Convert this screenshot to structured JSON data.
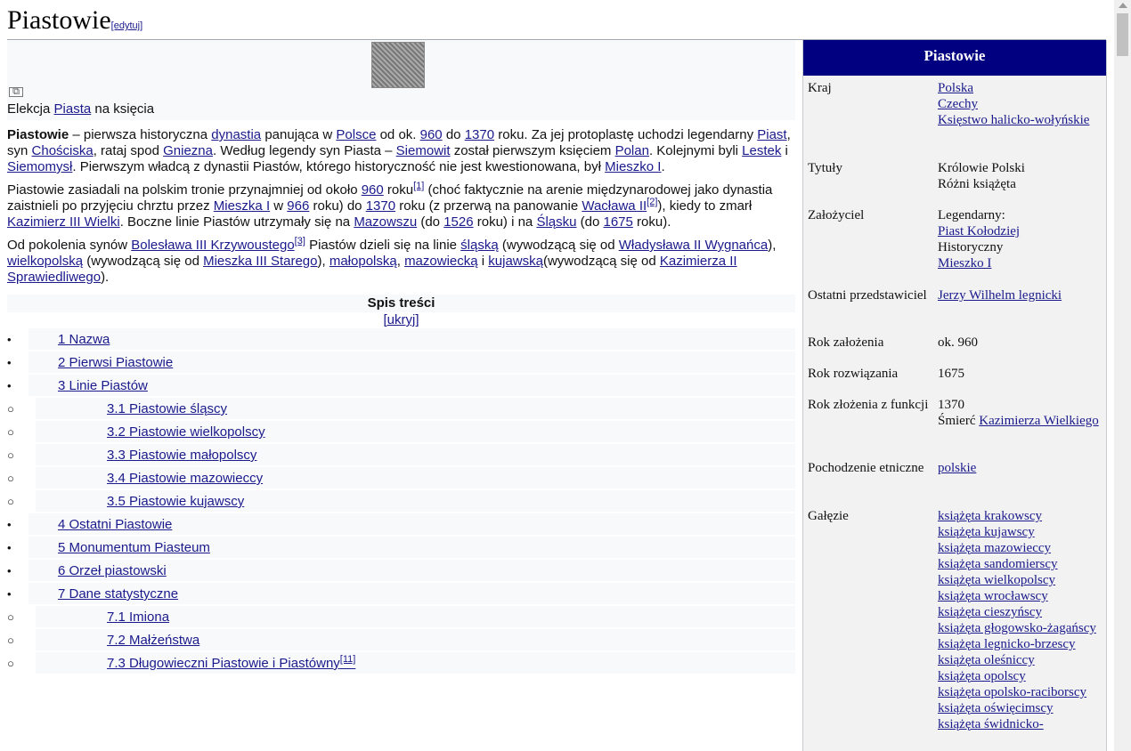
{
  "header": {
    "title": "Piastowie",
    "edit": "[edytuj]"
  },
  "figure": {
    "caption_pre": "Elekcja ",
    "caption_link": "Piasta",
    "caption_post": " na księcia"
  },
  "paragraphs": [
    [
      {
        "t": "b",
        "v": "Piastowie"
      },
      {
        "t": "s",
        "v": " – pierwsza historyczna "
      },
      {
        "t": "a",
        "v": "dynastia"
      },
      {
        "t": "s",
        "v": " panująca w "
      },
      {
        "t": "a",
        "v": "Polsce"
      },
      {
        "t": "s",
        "v": " od ok. "
      },
      {
        "t": "a",
        "v": "960"
      },
      {
        "t": "s",
        "v": " do "
      },
      {
        "t": "a",
        "v": "1370"
      },
      {
        "t": "s",
        "v": " roku. Za jej protoplastę uchodzi legendarny "
      },
      {
        "t": "a",
        "v": "Piast"
      },
      {
        "t": "s",
        "v": ", syn "
      },
      {
        "t": "a",
        "v": "Chościska"
      },
      {
        "t": "s",
        "v": ", rataj spod "
      },
      {
        "t": "a",
        "v": "Gniezna"
      },
      {
        "t": "s",
        "v": ". Według legendy syn Piasta – "
      },
      {
        "t": "a",
        "v": "Siemowit"
      },
      {
        "t": "s",
        "v": " został pierwszym księciem "
      },
      {
        "t": "a",
        "v": "Polan"
      },
      {
        "t": "s",
        "v": ". Kolejnymi byli "
      },
      {
        "t": "a",
        "v": "Lestek"
      },
      {
        "t": "s",
        "v": " i "
      },
      {
        "t": "a",
        "v": "Siemomysł"
      },
      {
        "t": "s",
        "v": ". Pierwszym władcą z dynastii Piastów, którego historyczność nie jest kwestionowana, był "
      },
      {
        "t": "a",
        "v": "Mieszko I"
      },
      {
        "t": "s",
        "v": "."
      }
    ],
    [
      {
        "t": "s",
        "v": "Piastowie zasiadali na polskim tronie przynajmniej od około "
      },
      {
        "t": "a",
        "v": "960"
      },
      {
        "t": "s",
        "v": " roku"
      },
      {
        "t": "sup",
        "v": "[1]"
      },
      {
        "t": "s",
        "v": " (choć faktycznie na arenie międzynarodowej jako dynastia zaistnieli po przyjęciu chrztu przez "
      },
      {
        "t": "a",
        "v": "Mieszka I"
      },
      {
        "t": "s",
        "v": " w "
      },
      {
        "t": "a",
        "v": "966"
      },
      {
        "t": "s",
        "v": " roku) do "
      },
      {
        "t": "a",
        "v": "1370"
      },
      {
        "t": "s",
        "v": " roku (z przerwą na panowanie "
      },
      {
        "t": "a",
        "v": "Wacława II"
      },
      {
        "t": "sup",
        "v": "[2]"
      },
      {
        "t": "s",
        "v": "), kiedy to zmarł "
      },
      {
        "t": "a",
        "v": "Kazimierz III Wielki"
      },
      {
        "t": "s",
        "v": ". Boczne linie Piastów utrzymały się na "
      },
      {
        "t": "a",
        "v": "Mazowszu"
      },
      {
        "t": "s",
        "v": " (do "
      },
      {
        "t": "a",
        "v": "1526"
      },
      {
        "t": "s",
        "v": " roku) i na "
      },
      {
        "t": "a",
        "v": "Śląsku"
      },
      {
        "t": "s",
        "v": " (do "
      },
      {
        "t": "a",
        "v": "1675"
      },
      {
        "t": "s",
        "v": " roku)."
      }
    ],
    [
      {
        "t": "s",
        "v": "Od pokolenia synów "
      },
      {
        "t": "a",
        "v": "Bolesława III Krzywoustego"
      },
      {
        "t": "sup",
        "v": "[3]"
      },
      {
        "t": "s",
        "v": " Piastów dzieli się na linie "
      },
      {
        "t": "a",
        "v": "śląską"
      },
      {
        "t": "s",
        "v": " (wywodzącą się od "
      },
      {
        "t": "a",
        "v": "Władysława II Wygnańca"
      },
      {
        "t": "s",
        "v": "), "
      },
      {
        "t": "a",
        "v": "wielkopolską"
      },
      {
        "t": "s",
        "v": " (wywodzącą się od "
      },
      {
        "t": "a",
        "v": "Mieszka III Starego"
      },
      {
        "t": "s",
        "v": "), "
      },
      {
        "t": "a",
        "v": "małopolską"
      },
      {
        "t": "s",
        "v": ", "
      },
      {
        "t": "a",
        "v": "mazowiecką"
      },
      {
        "t": "s",
        "v": " i "
      },
      {
        "t": "a",
        "v": "kujawską"
      },
      {
        "t": "s",
        "v": "(wywodzącą się od "
      },
      {
        "t": "a",
        "v": "Kazimierza II Sprawiedliwego"
      },
      {
        "t": "s",
        "v": ")."
      }
    ]
  ],
  "toc": {
    "title": "Spis treści",
    "hide": "[ukryj]",
    "items": [
      {
        "level": 1,
        "label": "1 Nazwa"
      },
      {
        "level": 1,
        "label": "2 Pierwsi Piastowie"
      },
      {
        "level": 1,
        "label": "3 Linie Piastów"
      },
      {
        "level": 2,
        "label": "3.1 Piastowie śląscy"
      },
      {
        "level": 2,
        "label": "3.2 Piastowie wielkopolscy"
      },
      {
        "level": 2,
        "label": "3.3 Piastowie małopolscy"
      },
      {
        "level": 2,
        "label": "3.4 Piastowie mazowieccy"
      },
      {
        "level": 2,
        "label": "3.5 Piastowie kujawscy"
      },
      {
        "level": 1,
        "label": "4 Ostatni Piastowie"
      },
      {
        "level": 1,
        "label": "5 Monumentum Piasteum"
      },
      {
        "level": 1,
        "label": "6 Orzeł piastowski"
      },
      {
        "level": 1,
        "label": "7 Dane statystyczne"
      },
      {
        "level": 2,
        "label": "7.1 Imiona"
      },
      {
        "level": 2,
        "label": "7.2 Małżeństwa"
      },
      {
        "level": 2,
        "label": "7.3 Długowieczni Piastowie i Piastówny",
        "sup": "[11]"
      }
    ]
  },
  "infobox": {
    "title": "Piastowie",
    "rows": [
      {
        "label": "Kraj",
        "value": [
          {
            "t": "a",
            "v": "Polska"
          },
          {
            "t": "br"
          },
          {
            "t": "a",
            "v": "Czechy"
          },
          {
            "t": "br"
          },
          {
            "t": "a",
            "v": "Księstwo halicko-wołyńskie"
          }
        ]
      },
      {
        "label": "Tytuły",
        "value": [
          {
            "t": "s",
            "v": "Królowie Polski"
          },
          {
            "t": "br"
          },
          {
            "t": "s",
            "v": "Różni książęta"
          }
        ]
      },
      {
        "label": "Założyciel",
        "value": [
          {
            "t": "s",
            "v": "Legendarny:"
          },
          {
            "t": "br"
          },
          {
            "t": "a",
            "v": "Piast Kołodziej"
          },
          {
            "t": "br"
          },
          {
            "t": "s",
            "v": "Historyczny"
          },
          {
            "t": "br"
          },
          {
            "t": "a",
            "v": "Mieszko I"
          }
        ]
      },
      {
        "label": "Ostatni przedstawiciel",
        "value": [
          {
            "t": "a",
            "v": "Jerzy Wilhelm legnicki"
          }
        ]
      },
      {
        "label": "Rok założenia",
        "value": [
          {
            "t": "s",
            "v": "ok. 960"
          }
        ]
      },
      {
        "label": "Rok rozwiązania",
        "value": [
          {
            "t": "s",
            "v": "1675"
          }
        ]
      },
      {
        "label": "Rok złożenia z funkcji",
        "value": [
          {
            "t": "s",
            "v": "1370"
          },
          {
            "t": "br"
          },
          {
            "t": "s",
            "v": "Śmierć "
          },
          {
            "t": "a",
            "v": "Kazimierza Wielkiego"
          }
        ]
      },
      {
        "label": "Pochodzenie etniczne",
        "value": [
          {
            "t": "a",
            "v": "polskie"
          }
        ]
      },
      {
        "label": "Gałęzie",
        "value": [
          {
            "t": "a",
            "v": "książęta krakowscy"
          },
          {
            "t": "br"
          },
          {
            "t": "a",
            "v": "książęta kujawscy"
          },
          {
            "t": "br"
          },
          {
            "t": "a",
            "v": "książęta mazowieccy"
          },
          {
            "t": "br"
          },
          {
            "t": "a",
            "v": "książęta sandomierscy"
          },
          {
            "t": "br"
          },
          {
            "t": "a",
            "v": "książęta wielkopolscy"
          },
          {
            "t": "br"
          },
          {
            "t": "a",
            "v": "książęta wrocławscy"
          },
          {
            "t": "br"
          },
          {
            "t": "a",
            "v": "książęta cieszyńscy"
          },
          {
            "t": "br"
          },
          {
            "t": "a",
            "v": "książęta głogowsko-żagańscy"
          },
          {
            "t": "br"
          },
          {
            "t": "a",
            "v": "książęta legnicko-brzescy"
          },
          {
            "t": "br"
          },
          {
            "t": "a",
            "v": "książęta oleśniccy"
          },
          {
            "t": "br"
          },
          {
            "t": "a",
            "v": "książęta opolscy"
          },
          {
            "t": "br"
          },
          {
            "t": "a",
            "v": "książęta opolsko-raciborscy"
          },
          {
            "t": "br"
          },
          {
            "t": "a",
            "v": "książęta oświęcimscy"
          },
          {
            "t": "br"
          },
          {
            "t": "a",
            "v": "książęta świdnicko-"
          }
        ]
      }
    ]
  }
}
